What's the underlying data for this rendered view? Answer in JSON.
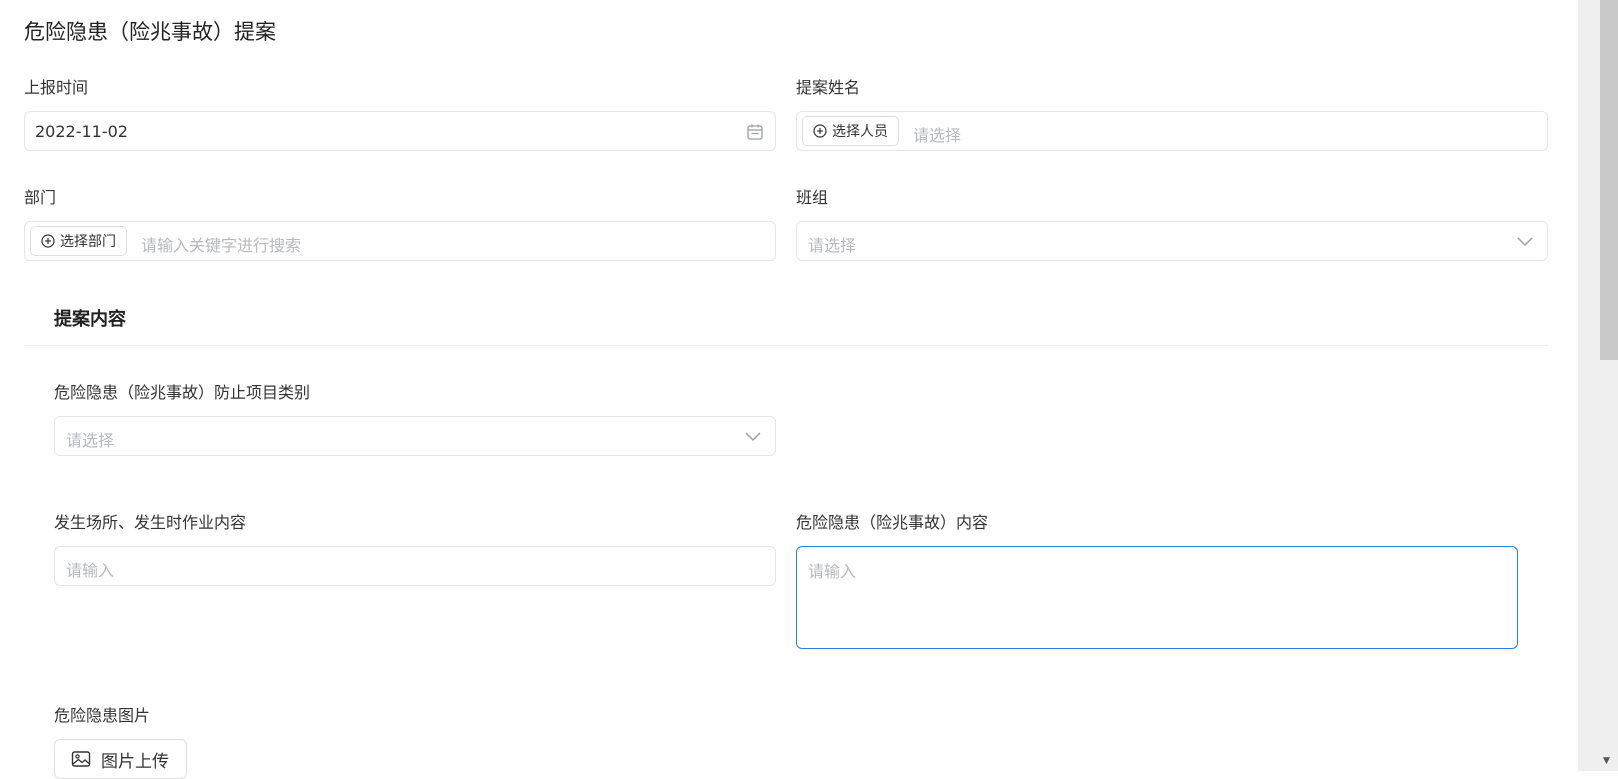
{
  "page": {
    "title": "危险隐患（险兆事故）提案"
  },
  "fields": {
    "report_time": {
      "label": "上报时间",
      "value": "2022-11-02"
    },
    "proposer": {
      "label": "提案姓名",
      "button": "选择人员",
      "placeholder": "请选择"
    },
    "department": {
      "label": "部门",
      "button": "选择部门",
      "placeholder": "请输入关键字进行搜索"
    },
    "team": {
      "label": "班组",
      "placeholder": "请选择"
    }
  },
  "section": {
    "title": "提案内容"
  },
  "content": {
    "category": {
      "label": "危险隐患（险兆事故）防止项目类别",
      "placeholder": "请选择"
    },
    "location": {
      "label": "发生场所、发生时作业内容",
      "placeholder": "请输入"
    },
    "hazard": {
      "label": "危险隐患（险兆事故）内容",
      "placeholder": "请输入"
    },
    "image": {
      "label": "危险隐患图片",
      "button": "图片上传"
    }
  },
  "icons": {
    "calendar": "calendar-icon",
    "plus_circle": "plus-circle-icon",
    "chevron": "chevron-down-icon",
    "image": "image-icon"
  },
  "colors": {
    "focus_border": "#2f7fd2",
    "placeholder": "#b6b9be",
    "border": "#e4e6ea"
  }
}
